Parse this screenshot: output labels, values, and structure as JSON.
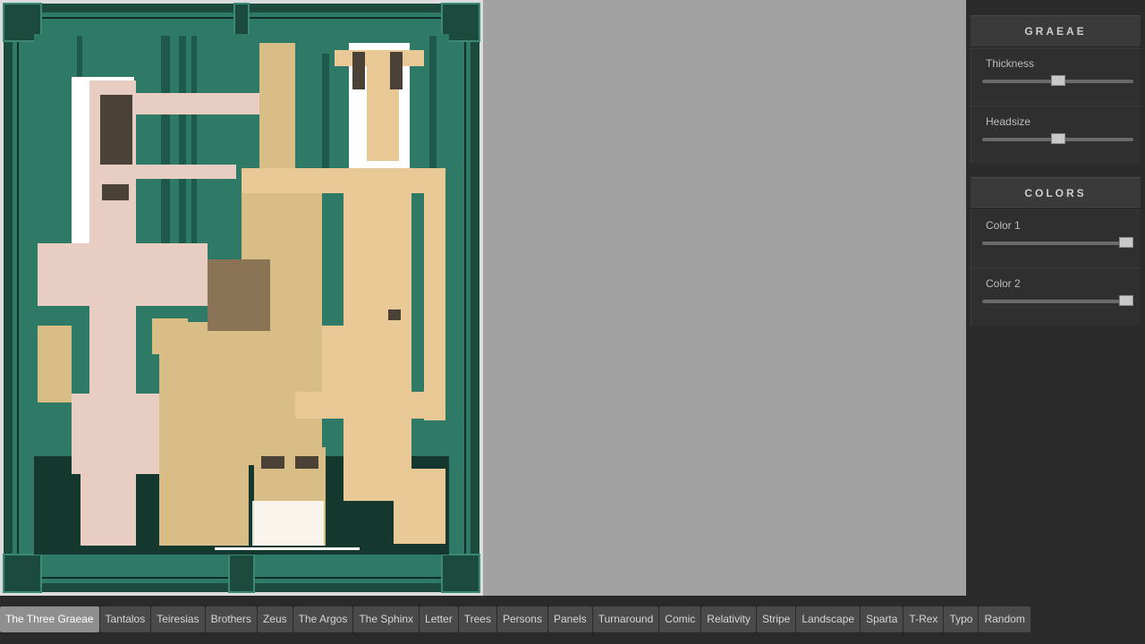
{
  "controls": {
    "sections": [
      {
        "title": "GRAEAE",
        "sliders": [
          {
            "label": "Thickness",
            "value": 0.5
          },
          {
            "label": "Headsize",
            "value": 0.5
          }
        ]
      },
      {
        "title": "COLORS",
        "sliders": [
          {
            "label": "Color 1",
            "value": 1.0
          },
          {
            "label": "Color 2",
            "value": 1.0
          }
        ]
      }
    ]
  },
  "tabs": [
    {
      "label": "The Three Graeae",
      "active": true
    },
    {
      "label": "Tantalos"
    },
    {
      "label": "Teiresias"
    },
    {
      "label": "Brothers"
    },
    {
      "label": "Zeus"
    },
    {
      "label": "The Argos"
    },
    {
      "label": "The Sphinx"
    },
    {
      "label": "Letter"
    },
    {
      "label": "Trees"
    },
    {
      "label": "Persons"
    },
    {
      "label": "Panels"
    },
    {
      "label": "Turnaround"
    },
    {
      "label": "Comic"
    },
    {
      "label": "Relativity"
    },
    {
      "label": "Stripe"
    },
    {
      "label": "Landscape"
    },
    {
      "label": "Sparta"
    },
    {
      "label": "T-Rex"
    },
    {
      "label": "Typo"
    },
    {
      "label": "Random"
    }
  ],
  "colors": {
    "frame": "#1c4a3c",
    "frame_light": "#3b8a75",
    "background": "#2f7a67",
    "background_dark": "#14382d",
    "pink_figure": "#e8cdc2",
    "tan_figure": "#e8c894",
    "olive_figure": "#d8bd86",
    "shadow": "#4b4237"
  }
}
